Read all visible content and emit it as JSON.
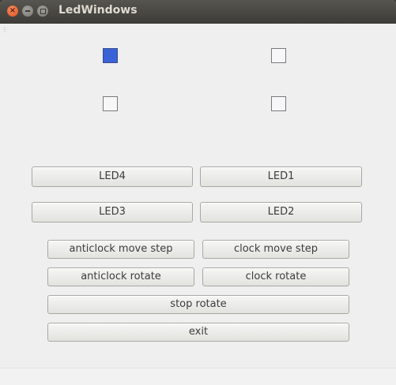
{
  "window": {
    "title": "LedWindows"
  },
  "leds": [
    {
      "name": "LED4",
      "on": true
    },
    {
      "name": "LED1",
      "on": false
    },
    {
      "name": "LED3",
      "on": false
    },
    {
      "name": "LED2",
      "on": false
    }
  ],
  "buttons": {
    "led4": "LED4",
    "led1": "LED1",
    "led3": "LED3",
    "led2": "LED2",
    "anticlock_move_step": "anticlock move step",
    "clock_move_step": "clock move step",
    "anticlock_rotate": "anticlock rotate",
    "clock_rotate": "clock rotate",
    "stop_rotate": "stop rotate",
    "exit": "exit"
  },
  "colors": {
    "led_on": "#3a63d8",
    "led_off": "#f7f7f9",
    "titlebar": "#3c3b37",
    "close_button": "#e2521c"
  }
}
